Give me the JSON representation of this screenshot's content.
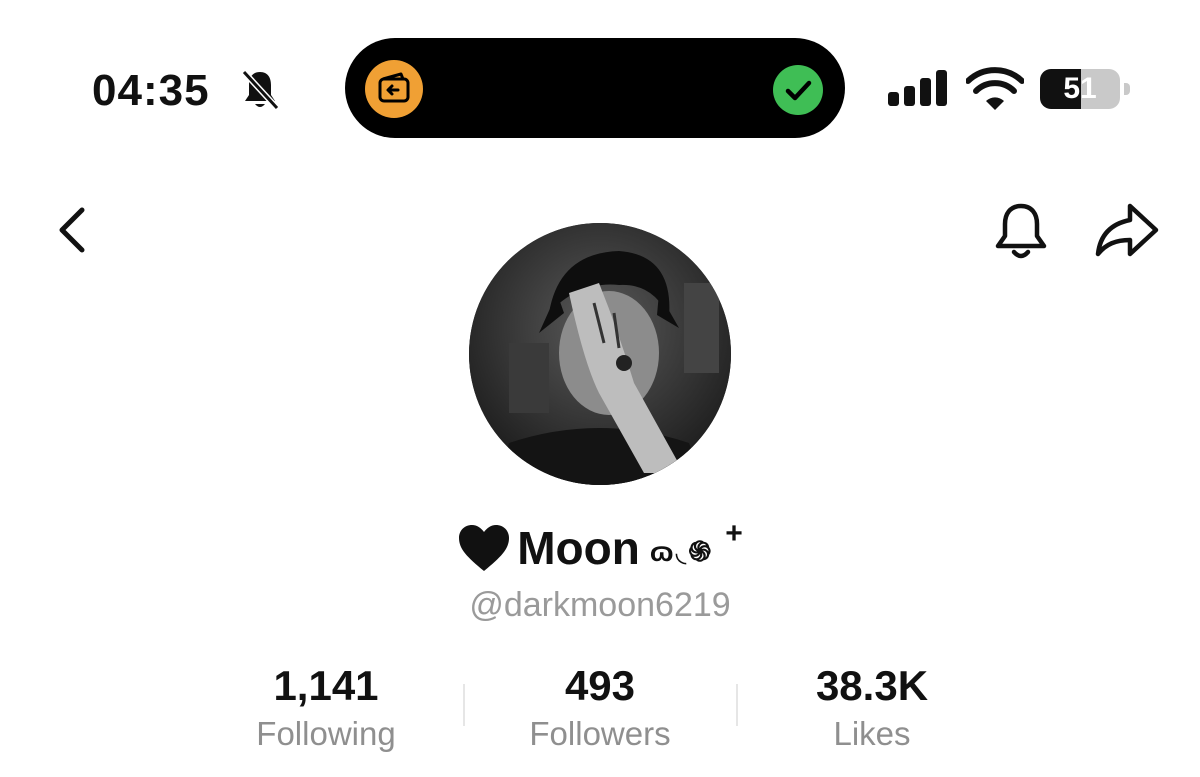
{
  "status_bar": {
    "time": "04:35",
    "battery_level": "51",
    "battery_fraction": 0.51
  },
  "profile": {
    "display_name": "Moon",
    "name_decoration": "ɷ◟֍",
    "name_plus": "+",
    "username": "@darkmoon6219"
  },
  "stats": {
    "following": {
      "value": "1,141",
      "label": "Following"
    },
    "followers": {
      "value": "493",
      "label": "Followers"
    },
    "likes": {
      "value": "38.3K",
      "label": "Likes"
    }
  },
  "icons": {
    "silent": "bell-slash-icon",
    "island_left": "wallet-icon",
    "island_right": "checkmark-icon",
    "back": "chevron-left-icon",
    "notify": "bell-icon",
    "share": "share-arrow-icon",
    "heart": "black-heart-icon"
  },
  "colors": {
    "island_wallet": "#f0a034",
    "island_check": "#3fbe55",
    "secondary_text": "#9a9a9a"
  }
}
